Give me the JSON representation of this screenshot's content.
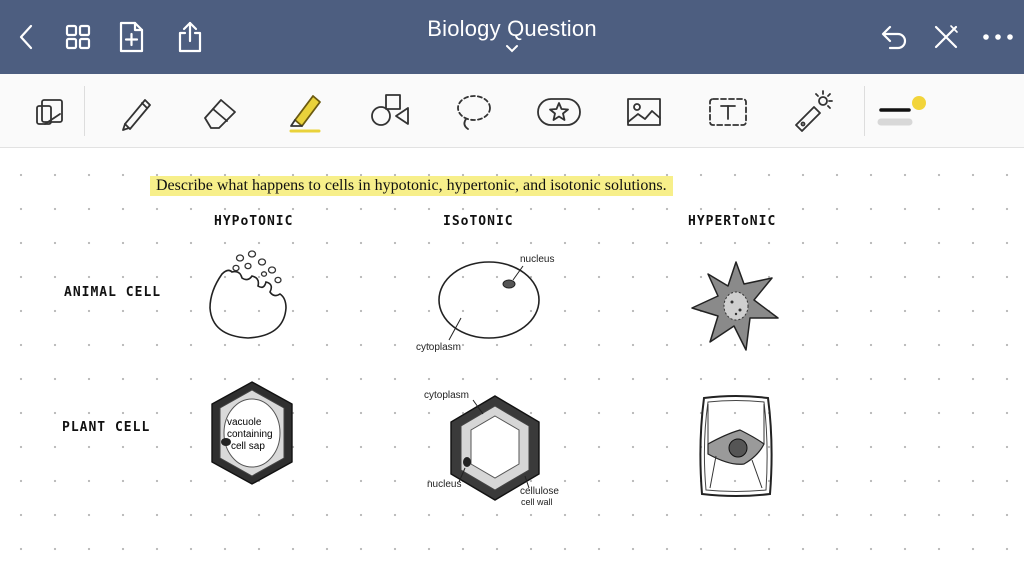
{
  "topbar": {
    "title": "Biology Question",
    "icons": [
      "back-chevron-icon",
      "grid-view-icon",
      "new-page-icon",
      "share-icon",
      "undo-icon",
      "clear-icon",
      "more-icon"
    ]
  },
  "toolbar": {
    "tools": [
      "page-layout-icon",
      "pen-icon",
      "eraser-icon",
      "highlighter-icon",
      "shapes-icon",
      "lasso-icon",
      "sticker-icon",
      "image-icon",
      "text-box-icon",
      "laser-pointer-icon",
      "stroke-width-icon"
    ],
    "highlighter_color": "#e9d23b",
    "active_color": "#f2d43a"
  },
  "page": {
    "question": "Describe what happens to cells in hypotonic, hypertonic, and isotonic solutions.",
    "columns": {
      "hypotonic": "HYPoTONIC",
      "isotonic": "ISoTONIC",
      "hypertonic": "HYPERToNIC"
    },
    "rows": {
      "animal": "ANIMAL  CELL",
      "plant": "PLANT  CELL"
    },
    "labels": {
      "nucleus_animal": "nucleus",
      "cytoplasm_animal": "cytoplasm",
      "vacuole_line1": "vacuole",
      "vacuole_line2": "containing",
      "vacuole_line3": "cell sap",
      "cytoplasm_plant": "cytoplasm",
      "nucleus_plant": "nucleus",
      "cellulose_line1": "cellulose",
      "cellulose_line2": "cell wall"
    }
  }
}
